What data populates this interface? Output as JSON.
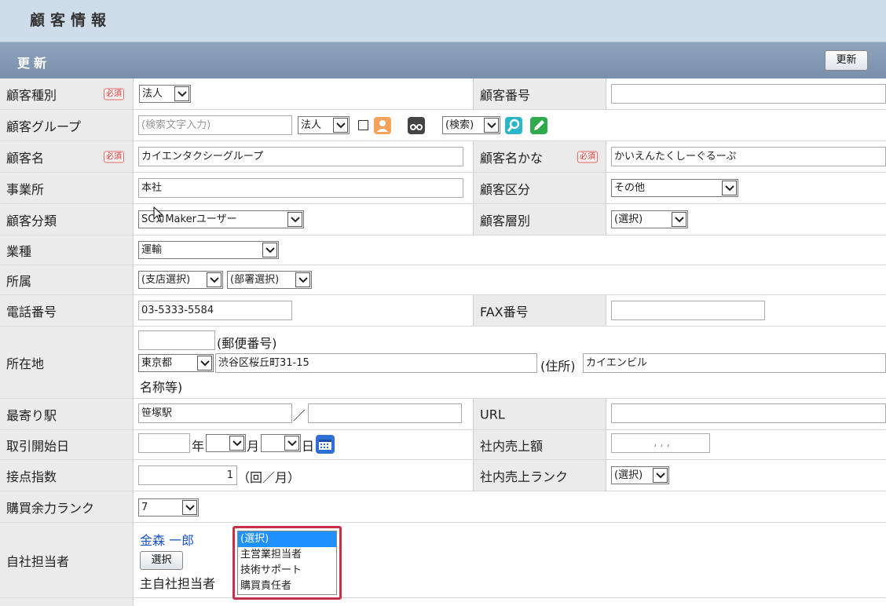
{
  "header": {
    "title": "顧客情報"
  },
  "section": {
    "title": "更新",
    "update_button": "更新"
  },
  "required_label": "必須",
  "rows": {
    "customer_type": {
      "label": "顧客種別",
      "value": "法人"
    },
    "customer_number": {
      "label": "顧客番号",
      "value": ""
    },
    "customer_group": {
      "label": "顧客グループ",
      "search_placeholder": "(検索文字入力)",
      "type_value": "法人",
      "search_select": "(検索)"
    },
    "customer_name": {
      "label": "顧客名",
      "value": "カイエンタクシーグループ"
    },
    "customer_kana": {
      "label": "顧客名かな",
      "value": "かいえんたくしーぐるーぷ"
    },
    "office": {
      "label": "事業所",
      "value": "本社"
    },
    "customer_division": {
      "label": "顧客区分",
      "value": "その他"
    },
    "customer_class": {
      "label": "顧客分類",
      "value": "SCカMakerユーザー"
    },
    "customer_tier": {
      "label": "顧客層別",
      "value": "(選択)"
    },
    "industry": {
      "label": "業種",
      "value": "運輸"
    },
    "affiliation": {
      "label": "所属",
      "branch": "(支店選択)",
      "dept": "(部署選択)"
    },
    "phone": {
      "label": "電話番号",
      "value": "03-5333-5584"
    },
    "fax": {
      "label": "FAX番号",
      "value": ""
    },
    "address": {
      "label": "所在地",
      "postal_value": "",
      "postal_label": "(郵便番号)",
      "prefecture": "東京都",
      "street": "渋谷区桜丘町31-15",
      "address_label": "(住所)",
      "building": "カイエンビル",
      "building_label": "名称等)"
    },
    "nearest_station": {
      "label": "最寄り駅",
      "value1": "笹塚駅",
      "separator": "／",
      "value2": ""
    },
    "url": {
      "label": "URL",
      "value": ""
    },
    "trade_start": {
      "label": "取引開始日",
      "year_label": "年",
      "month_label": "月",
      "day_label": "日"
    },
    "internal_sales": {
      "label": "社内売上額",
      "value": ",   ,   ,"
    },
    "contact_index": {
      "label": "接点指数",
      "value": "1",
      "unit": "（回／月）"
    },
    "sales_rank": {
      "label": "社内売上ランク",
      "value": "(選択)"
    },
    "purchase_rank": {
      "label": "購買余力ランク",
      "value": "7"
    },
    "staff": {
      "label": "自社担当者",
      "name": "金森 一郎",
      "select_button": "選択",
      "main_label": "主自社担当者"
    }
  },
  "role_dropdown": {
    "options": [
      "(選択)",
      "主営業担当者",
      "技術サポート",
      "購買責任者"
    ],
    "selected_index": 0
  },
  "colors": {
    "header_bg": "#cfdce9",
    "section_bg": "#8197b1",
    "highlight": "#c5304a",
    "selected": "#1e90ff"
  },
  "icons": [
    "person-icon",
    "binoculars-icon",
    "search-icon",
    "edit-icon",
    "calendar-icon",
    "dropdown-arrow-icon"
  ]
}
